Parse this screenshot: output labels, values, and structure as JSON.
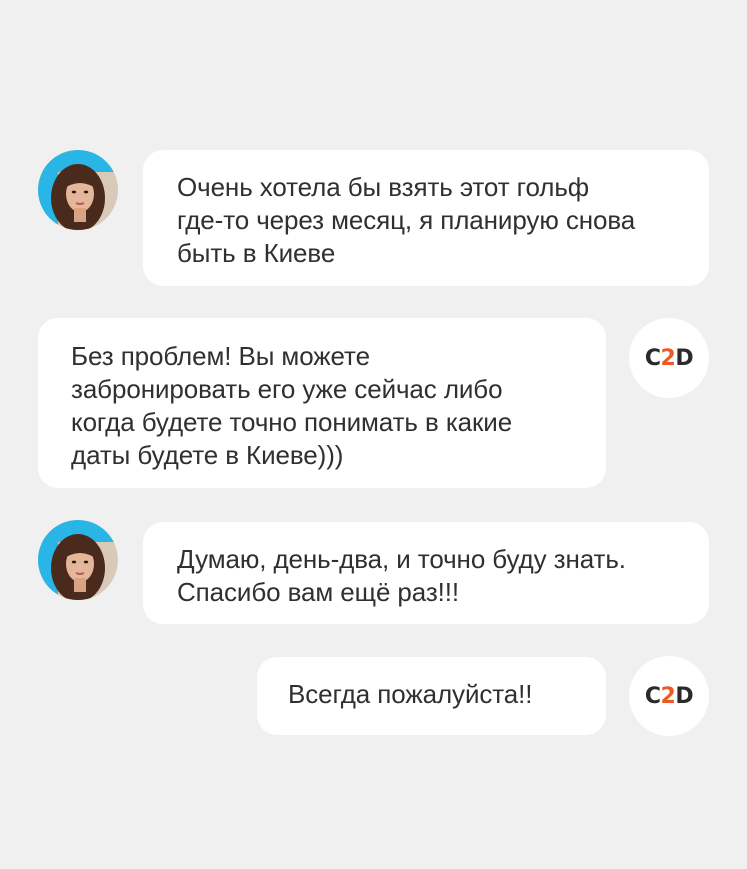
{
  "chat": {
    "messages": [
      {
        "sender": "user",
        "lines": [
          "Очень хотела бы взять этот гольф",
          "где-то через месяц, я планирую снова",
          "быть в Киеве"
        ]
      },
      {
        "sender": "company",
        "lines": [
          "Без проблем! Вы можете",
          "забронировать его уже сейчас либо",
          "когда будете точно понимать в какие",
          "даты будете в Киеве)))"
        ]
      },
      {
        "sender": "user",
        "lines": [
          "Думаю, день-два, и точно буду знать.",
          "Спасибо вам ещё раз!!!"
        ]
      },
      {
        "sender": "company",
        "lines": [
          "Всегда пожалуйста!!"
        ]
      }
    ]
  },
  "logo": {
    "left": "C",
    "middle": "2",
    "right": "D",
    "accent_color": "#ef5a24"
  },
  "avatar": {
    "icon": "user-avatar-photo",
    "accent_color": "#29b6e6"
  },
  "colors": {
    "background": "#f0f0f0",
    "bubble": "#ffffff",
    "text": "#303030"
  }
}
